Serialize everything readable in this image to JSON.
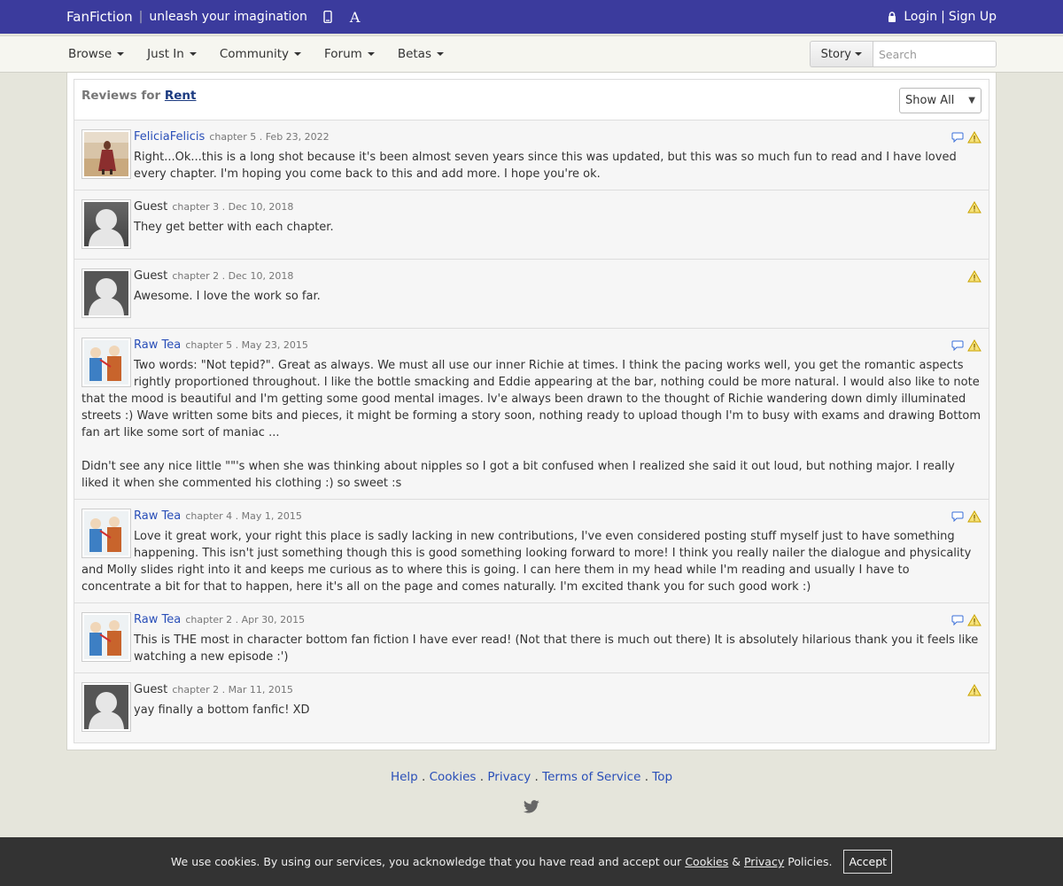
{
  "topbar": {
    "brand": "FanFiction",
    "separator": "|",
    "tagline": "unleash your imagination",
    "font_icon_glyph": "A",
    "login": "Login",
    "pipe": "|",
    "signup": "Sign Up"
  },
  "nav": {
    "items": [
      "Browse",
      "Just In",
      "Community",
      "Forum",
      "Betas"
    ],
    "story_label": "Story",
    "search_placeholder": "Search"
  },
  "reviews": {
    "title_prefix": "Reviews for",
    "story_title": "Rent",
    "filter_value": "Show All",
    "items": [
      {
        "user": "FeliciaFelicis",
        "meta": "chapter 5 . Feb 23, 2022",
        "text": "Right...Ok...this is a long shot because it's been almost seven years since this was updated, but this was so much fun to read and I have loved every chapter. I'm hoping you come back to this and add more. I hope you're ok."
      },
      {
        "user": "Guest",
        "meta": "chapter 3 . Dec 10, 2018",
        "text": "They get better with each chapter."
      },
      {
        "user": "Guest",
        "meta": "chapter 2 . Dec 10, 2018",
        "text": "Awesome. I love the work so far."
      },
      {
        "user": "Raw Tea",
        "meta": "chapter 5 . May 23, 2015",
        "text": "Two words: \"Not tepid?\". Great as always. We must all use our inner Richie at times. I think the pacing works well, you get the romantic aspects rightly proportioned throughout. I like the bottle smacking and Eddie appearing at the bar, nothing could be more natural. I would also like to note that the mood is beautiful and I'm getting some good mental images. Iv'e always been drawn to the thought of Richie wandering down dimly illuminated streets :) Wave written some bits and pieces, it might be forming a story soon, nothing ready to upload though I'm to busy with exams and drawing Bottom fan art like some sort of maniac ...",
        "text2": "Didn't see any nice little \"\"'s when she was thinking about nipples so I got a bit confused when I realized she said it out loud, but nothing major. I really liked it when she commented his clothing :) so sweet :s"
      },
      {
        "user": "Raw Tea",
        "meta": "chapter 4 . May 1, 2015",
        "text": "Love it great work, your right this place is sadly lacking in new contributions, I've even considered posting stuff myself just to have something happening. This isn't just something though this is good something looking forward to more! I think you really nailer the dialogue and physicality and Molly slides right into it and keeps me curious as to where this is going. I can here them in my head while I'm reading and usually I have to concentrate a bit for that to happen, here it's all on the page and comes naturally. I'm excited thank you for such good work :)"
      },
      {
        "user": "Raw Tea",
        "meta": "chapter 2 . Apr 30, 2015",
        "text": "This is THE most in character bottom fan fiction I have ever read! (Not that there is much out there) It is absolutely hilarious thank you it feels like watching a new episode :')"
      },
      {
        "user": "Guest",
        "meta": "chapter 2 . Mar 11, 2015",
        "text": "yay finally a bottom fanfic! XD"
      }
    ]
  },
  "footer": {
    "help": "Help",
    "cookies": "Cookies",
    "privacy": "Privacy",
    "terms": "Terms of Service",
    "top": "Top",
    "dot": "."
  },
  "cookie_bar": {
    "text_before": "We use cookies. By using our services, you acknowledge that you have read and accept our",
    "cookies_link": "Cookies",
    "amp": "&",
    "privacy_link": "Privacy",
    "text_after": "Policies.",
    "accept": "Accept"
  },
  "colors": {
    "topbar": "#3b3b9d",
    "link": "#2a4fb8",
    "page_bg": "#e5e5db",
    "cookie_bg": "#333333"
  },
  "icons": [
    "mobile-icon",
    "font-size-icon",
    "lock-icon",
    "reply-icon",
    "warning-icon",
    "twitter-icon",
    "caret-down-icon"
  ]
}
